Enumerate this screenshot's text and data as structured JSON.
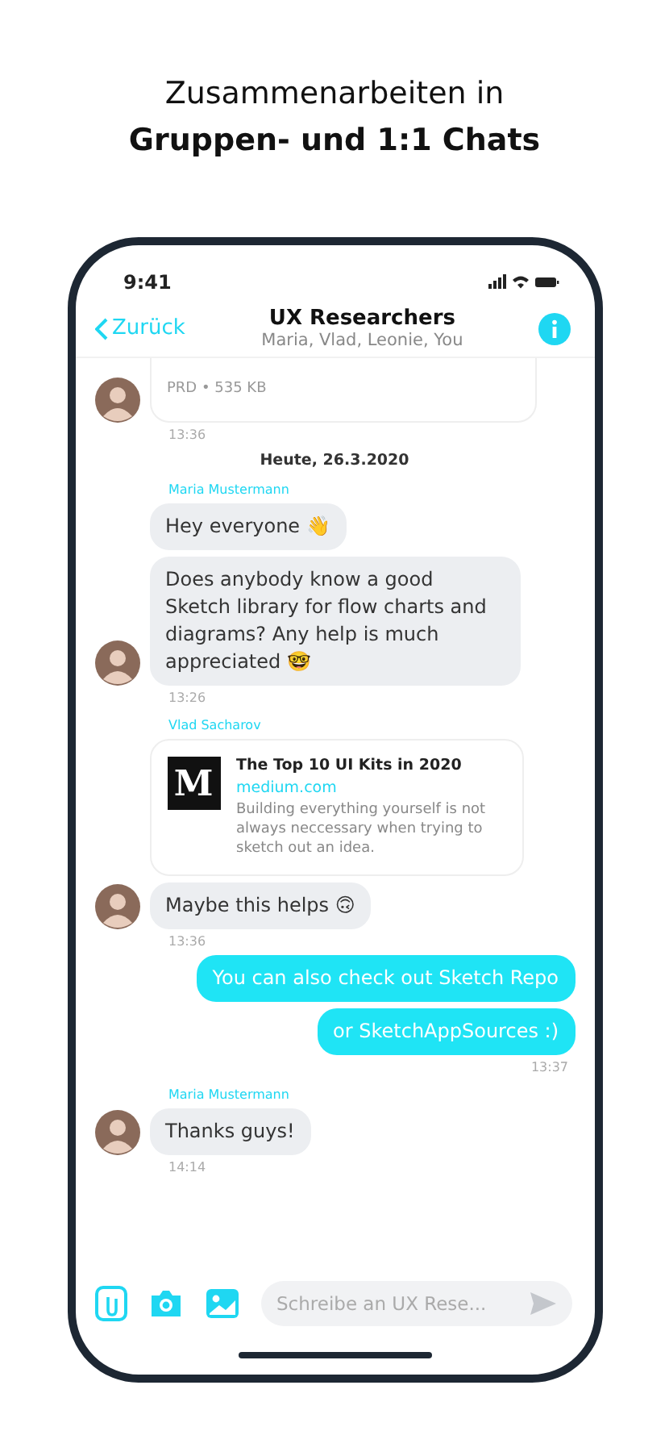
{
  "headline": {
    "line1": "Zusammenarbeiten in",
    "line2": "Gruppen- und 1:1 Chats"
  },
  "status": {
    "time": "9:41"
  },
  "header": {
    "back": "Zurück",
    "title": "UX Researchers",
    "members": "Maria, Vlad, Leonie, You"
  },
  "messages": [
    {
      "kind": "file",
      "meta": "PRD • 535 KB",
      "avatar": true
    },
    {
      "kind": "time_in",
      "text": "13:36"
    },
    {
      "kind": "date",
      "text": "Heute, 26.3.2020"
    },
    {
      "kind": "sender",
      "text": "Maria Mustermann"
    },
    {
      "kind": "incoming",
      "text": "Hey everyone 👋",
      "avatar": false
    },
    {
      "kind": "incoming",
      "text": "Does anybody know a good Sketch library for flow charts and diagrams? Any help is much appreciated 🤓",
      "avatar": true
    },
    {
      "kind": "time_in",
      "text": "13:26"
    },
    {
      "kind": "sender",
      "text": "Vlad Sacharov"
    },
    {
      "kind": "link",
      "logo": "M",
      "title": "The Top 10 UI Kits in 2020",
      "site": "medium.com",
      "desc": "Building everything yourself is not always neccessary when trying to sketch out an idea.",
      "avatar": false
    },
    {
      "kind": "incoming",
      "text": "Maybe this helps 🙃",
      "avatar": true
    },
    {
      "kind": "time_in",
      "text": "13:36"
    },
    {
      "kind": "outgoing",
      "text": "You can also check out Sketch Repo"
    },
    {
      "kind": "outgoing",
      "text": "or SketchAppSources :)"
    },
    {
      "kind": "time_out",
      "text": "13:37"
    },
    {
      "kind": "sender",
      "text": "Maria Mustermann"
    },
    {
      "kind": "incoming",
      "text": "Thanks guys!",
      "avatar": true
    },
    {
      "kind": "time_in",
      "text": "14:14"
    }
  ],
  "composer": {
    "placeholder": "Schreibe an UX Rese..."
  }
}
